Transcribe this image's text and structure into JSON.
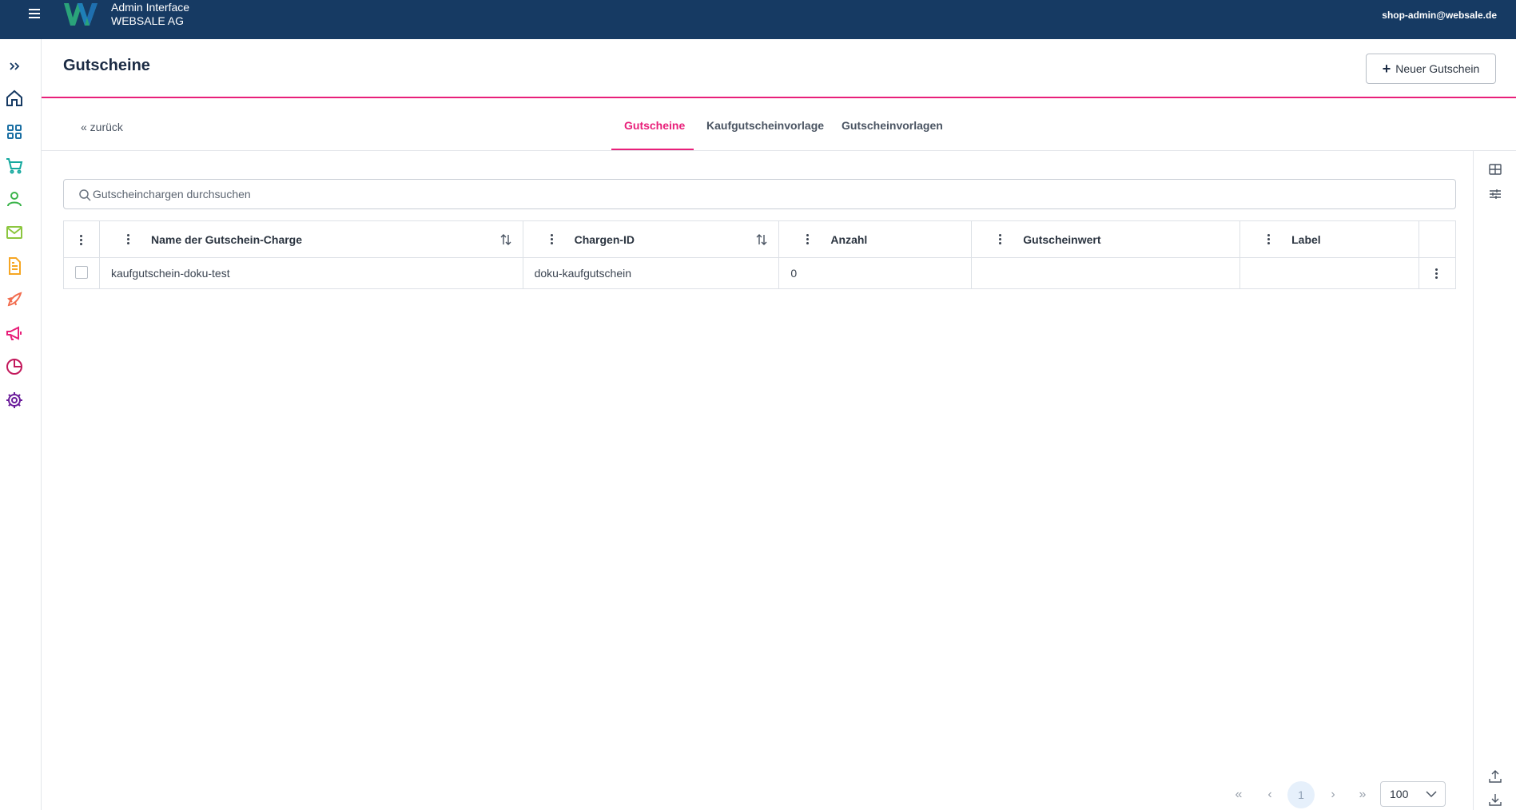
{
  "topbar": {
    "brand_line1": "Admin Interface",
    "brand_line2": "WEBSALE AG",
    "user_email": "shop-admin@websale.de"
  },
  "sidebar": {
    "items": [
      {
        "icon": "expand-icon",
        "color": "#163a63"
      },
      {
        "icon": "home-icon",
        "color": "#163a63"
      },
      {
        "icon": "dashboard-icon",
        "color": "#1a6fa3"
      },
      {
        "icon": "cart-icon",
        "color": "#13a89e"
      },
      {
        "icon": "user-icon",
        "color": "#3cb44b"
      },
      {
        "icon": "mail-icon",
        "color": "#8cc63f"
      },
      {
        "icon": "document-icon",
        "color": "#f6a623"
      },
      {
        "icon": "rocket-icon",
        "color": "#f26d4f"
      },
      {
        "icon": "megaphone-icon",
        "color": "#e8207a"
      },
      {
        "icon": "pie-chart-icon",
        "color": "#c2185b"
      },
      {
        "icon": "settings-icon",
        "color": "#6a1b9a"
      }
    ]
  },
  "header": {
    "title": "Gutscheine",
    "new_button_label": "Neuer Gutschein"
  },
  "nav": {
    "back_label": "« zurück",
    "tabs": [
      {
        "label": "Gutscheine",
        "active": true
      },
      {
        "label": "Kaufgutscheinvorlage",
        "active": false
      },
      {
        "label": "Gutscheinvorlagen",
        "active": false
      }
    ]
  },
  "search": {
    "placeholder": "Gutscheinchargen durchsuchen",
    "value": ""
  },
  "table": {
    "columns": [
      "Name der Gutschein-Charge",
      "Chargen-ID",
      "Anzahl",
      "Gutscheinwert",
      "Label"
    ],
    "rows": [
      {
        "name": "kaufgutschein-doku-test",
        "id": "doku-kaufgutschein",
        "count": "0",
        "value": "",
        "label": ""
      }
    ]
  },
  "pagination": {
    "current_page": "1",
    "page_size": "100"
  },
  "colors": {
    "topbar": "#163a63",
    "accent": "#e8207a"
  }
}
